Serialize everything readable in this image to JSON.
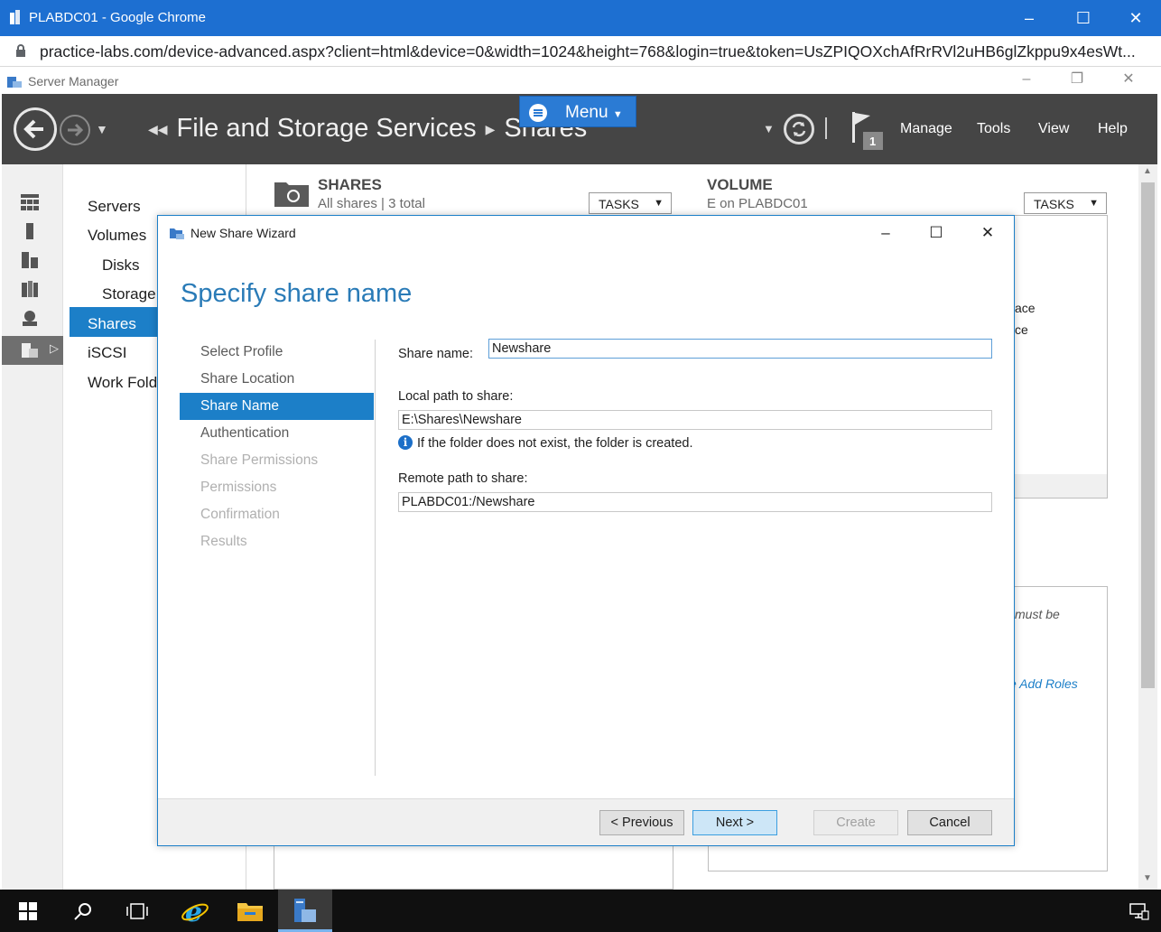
{
  "browser": {
    "window_title": "PLABDC01 - Google Chrome",
    "url": "practice-labs.com/device-advanced.aspx?client=html&device=0&width=1024&height=768&login=true&token=UsZPIQOXchAfRrRVl2uHB6glZkppu9x4esWt..."
  },
  "server_manager": {
    "window_title": "Server Manager",
    "breadcrumb": [
      "File and Storage Services",
      "Shares"
    ],
    "notification_count": "1",
    "header_menu": [
      "Manage",
      "Tools",
      "View",
      "Help"
    ],
    "overlay_menu_label": "Menu"
  },
  "nav": {
    "items": [
      {
        "label": "Servers"
      },
      {
        "label": "Volumes"
      },
      {
        "label": "Disks"
      },
      {
        "label": "Storage"
      },
      {
        "label": "Shares"
      },
      {
        "label": "iSCSI"
      },
      {
        "label": "Work Fold"
      }
    ],
    "selected": "Shares"
  },
  "tiles": {
    "shares": {
      "title": "SHARES",
      "subtitle": "All shares | 3 total",
      "tasks_label": "TASKS"
    },
    "volume": {
      "title": "VOLUME",
      "subtitle": "E on PLABDC01",
      "tasks_label": "TASKS"
    },
    "fragments": {
      "a": "ace",
      "b": "ce",
      "c": "must be",
      "d": "e Add Roles"
    }
  },
  "wizard": {
    "title": "New Share Wizard",
    "heading": "Specify share name",
    "steps": [
      {
        "label": "Select Profile",
        "state": "done"
      },
      {
        "label": "Share Location",
        "state": "done"
      },
      {
        "label": "Share Name",
        "state": "current"
      },
      {
        "label": "Authentication",
        "state": "done"
      },
      {
        "label": "Share Permissions",
        "state": "pending"
      },
      {
        "label": "Permissions",
        "state": "pending"
      },
      {
        "label": "Confirmation",
        "state": "pending"
      },
      {
        "label": "Results",
        "state": "pending"
      }
    ],
    "share_name_label": "Share name:",
    "share_name_value": "Newshare",
    "local_path_label": "Local path to share:",
    "local_path_value": "E:\\Shares\\Newshare",
    "info_text": "If the folder does not exist, the folder is created.",
    "remote_path_label": "Remote path to share:",
    "remote_path_value": "PLABDC01:/Newshare",
    "buttons": {
      "previous": "< Previous",
      "next": "Next >",
      "create": "Create",
      "cancel": "Cancel"
    }
  },
  "colors": {
    "chrome_titlebar": "#1d6fd1",
    "sm_header": "#454545",
    "selection": "#1c7fc8",
    "heading": "#2a7bb7"
  }
}
